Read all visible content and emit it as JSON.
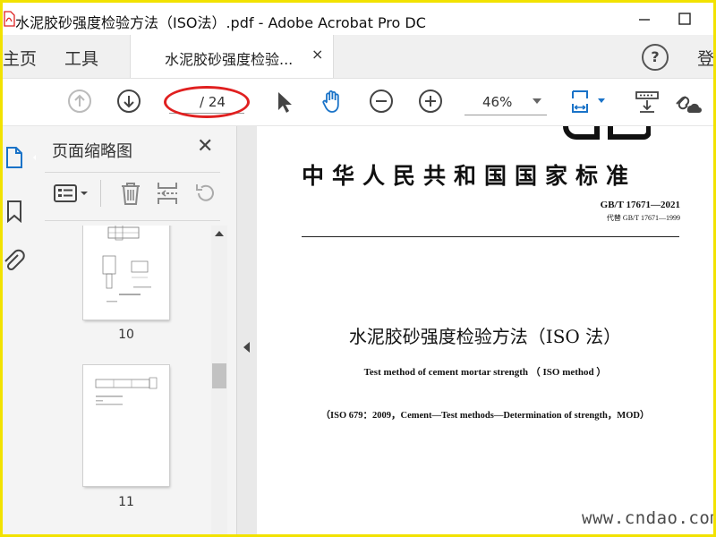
{
  "window": {
    "title": "水泥胶砂强度检验方法（ISO法）.pdf - Adobe Acrobat Pro DC"
  },
  "tabs": {
    "home": "主页",
    "tools": "工具",
    "document": "水泥胶砂强度检验...",
    "close_glyph": "×",
    "help_glyph": "?",
    "sign_in": "登"
  },
  "toolbar": {
    "page_total": "/ 24",
    "zoom": "46%",
    "icons": [
      "previous-page-icon",
      "next-page-icon",
      "select-pointer-icon",
      "hand-tool-icon",
      "zoom-out-icon",
      "zoom-in-icon",
      "page-display-icon",
      "scroll-mode-icon",
      "share-link-icon"
    ]
  },
  "rail": {
    "icons": [
      "page-thumbnails-icon",
      "bookmarks-icon",
      "attachments-icon"
    ]
  },
  "thumbnails_panel": {
    "title": "页面缩略图",
    "close_glyph": "✕",
    "icons": [
      "thumbnail-options-icon",
      "delete-page-icon",
      "insert-page-icon",
      "rotate-page-icon"
    ],
    "pages": [
      {
        "label": "10"
      },
      {
        "label": "11"
      }
    ]
  },
  "document": {
    "national_standard": "中华人民共和国国家标准",
    "standard_number": "GB/T 17671—2021",
    "replaces": "代替 GB/T 17671—1999",
    "title_cn": "水泥胶砂强度检验方法（ISO 法）",
    "title_en": "Test method of cement mortar strength （ ISO method ）",
    "iso_reference": "（ISO 679：2009，Cement—Test methods—Determination of strength，MOD）"
  },
  "watermark": "www.cndao.com",
  "colors": {
    "accent_blue": "#1a73c8",
    "highlight_red": "#e02020",
    "frame_yellow": "#f2e200"
  }
}
